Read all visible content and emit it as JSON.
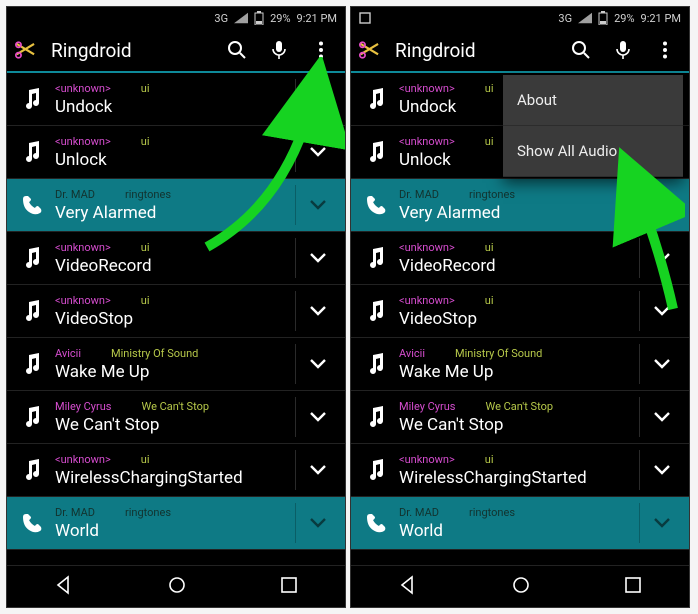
{
  "status": {
    "net": "3G",
    "battery": "29%",
    "time": "9:21 PM"
  },
  "app": {
    "title": "Ringdroid"
  },
  "menu": {
    "about": "About",
    "show_all": "Show All Audio"
  },
  "rows": [
    {
      "artist": "<unknown>",
      "album": "ui",
      "title": "Undock",
      "selected": false,
      "icon": "music"
    },
    {
      "artist": "<unknown>",
      "album": "ui",
      "title": "Unlock",
      "selected": false,
      "icon": "music"
    },
    {
      "artist": "Dr. MAD",
      "album": "ringtones",
      "title": "Very Alarmed",
      "selected": true,
      "icon": "phone"
    },
    {
      "artist": "<unknown>",
      "album": "ui",
      "title": "VideoRecord",
      "selected": false,
      "icon": "music"
    },
    {
      "artist": "<unknown>",
      "album": "ui",
      "title": "VideoStop",
      "selected": false,
      "icon": "music"
    },
    {
      "artist": "Avicii",
      "album": "Ministry Of Sound",
      "title": "Wake Me Up",
      "selected": false,
      "icon": "music"
    },
    {
      "artist": "Miley Cyrus",
      "album": "We Can't Stop",
      "title": "We Can't Stop",
      "selected": false,
      "icon": "music"
    },
    {
      "artist": "<unknown>",
      "album": "ui",
      "title": "WirelessChargingStarted",
      "selected": false,
      "icon": "music"
    },
    {
      "artist": "Dr. MAD",
      "album": "ringtones",
      "title": "World",
      "selected": true,
      "icon": "phone"
    }
  ],
  "annotations": {
    "left_arrow_target": "overflow-button",
    "right_arrow_target": "menu-show-all"
  }
}
